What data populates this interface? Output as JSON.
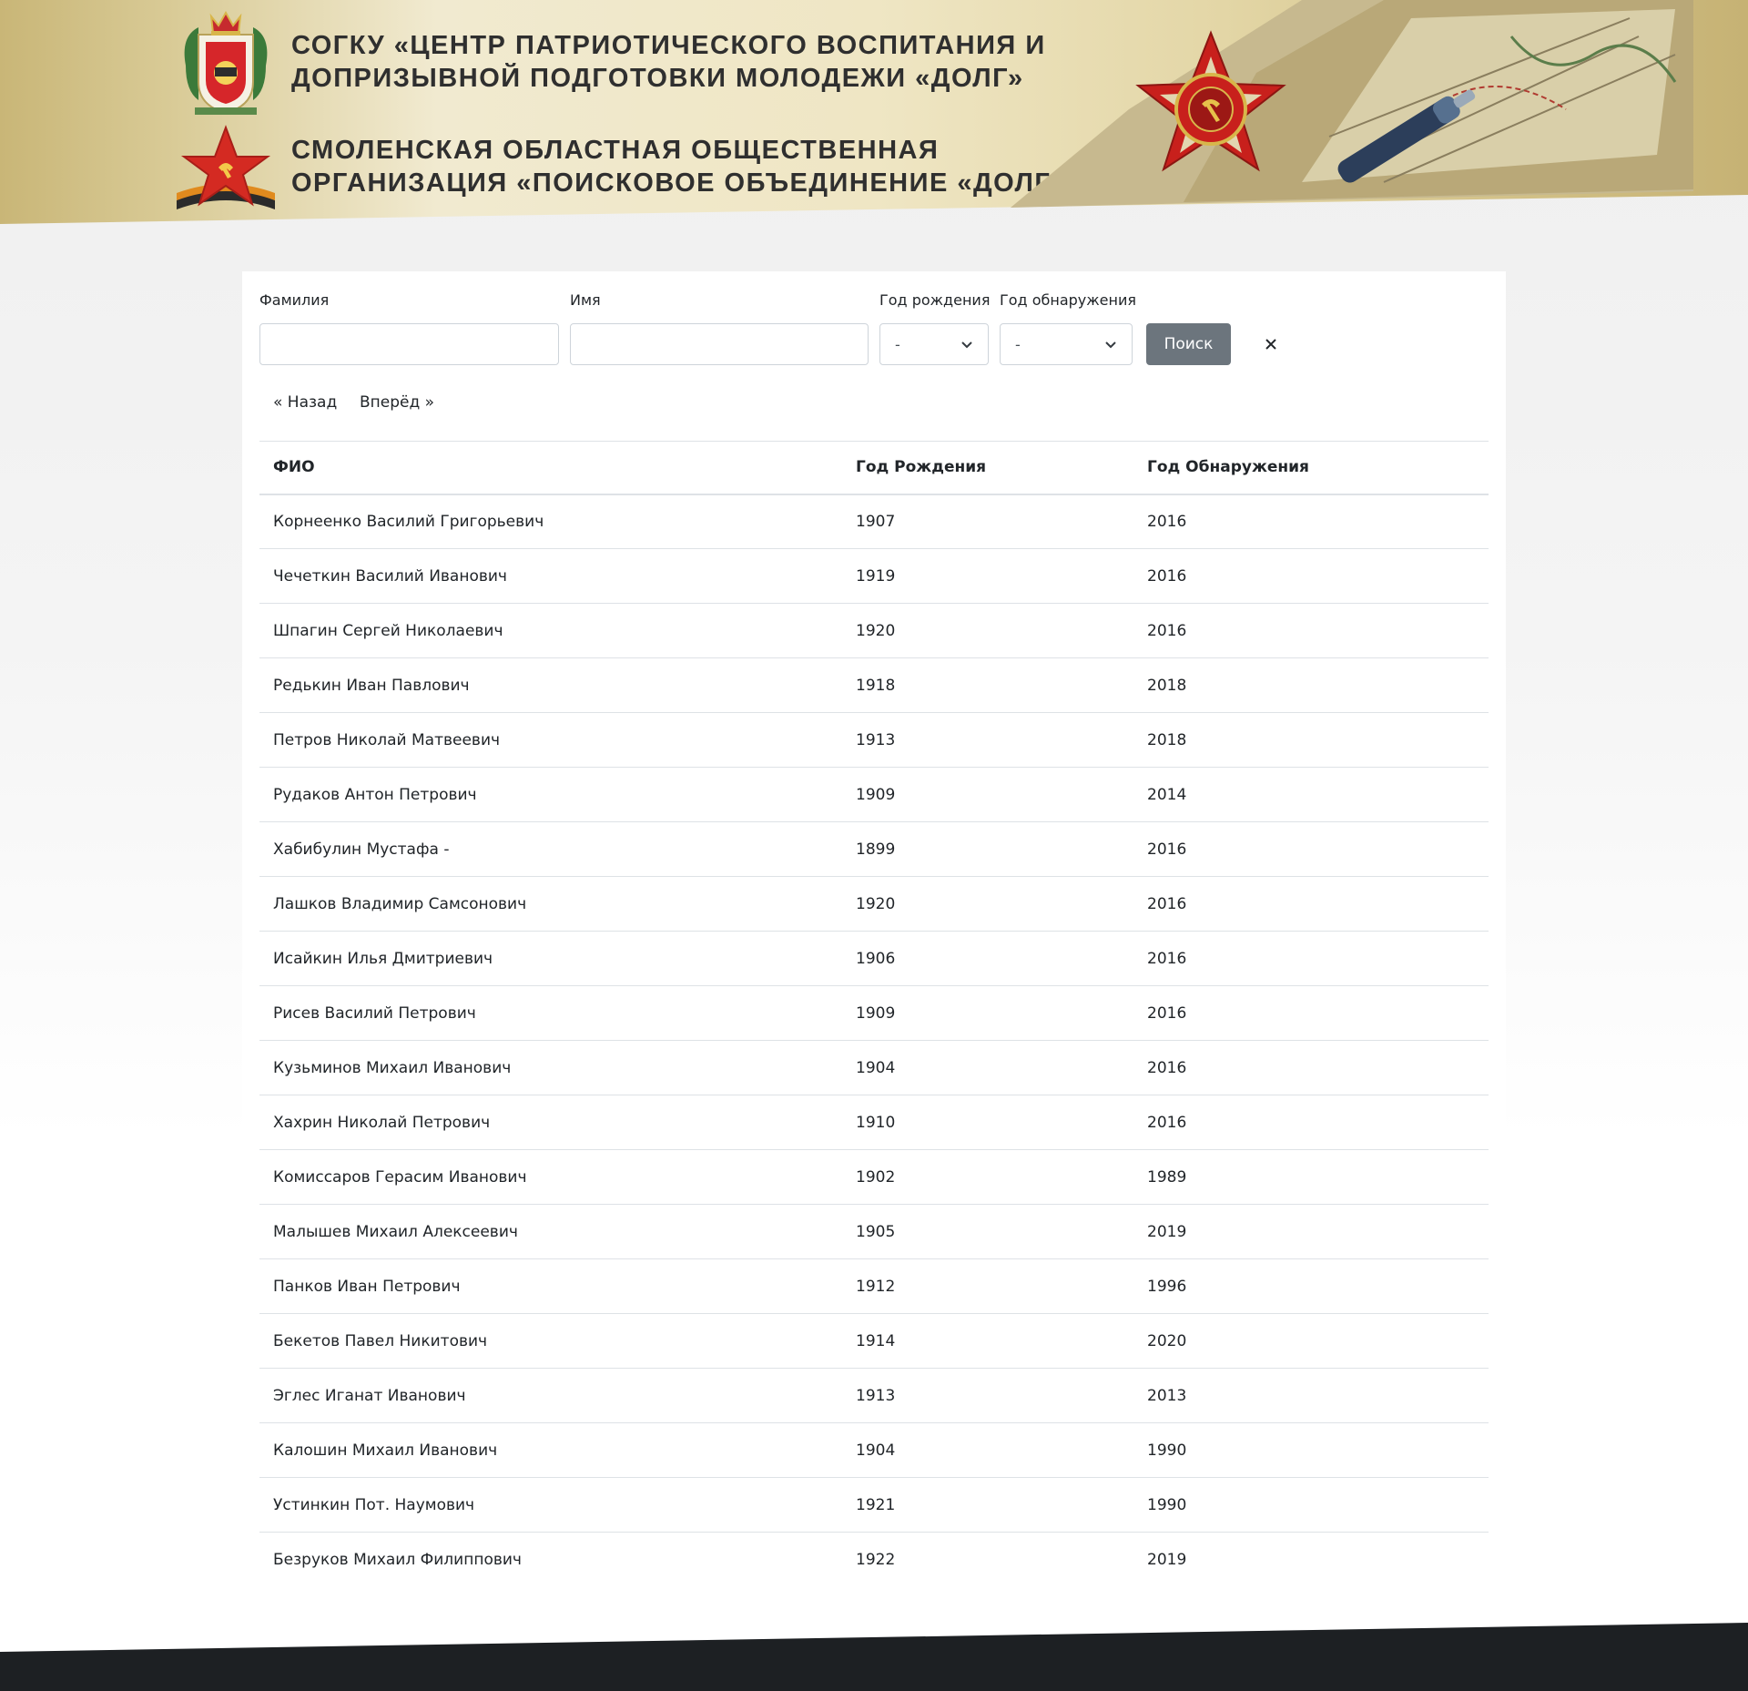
{
  "header": {
    "title_org1_line1": "СОГКУ «Центр патриотического воспитания и",
    "title_org1_line2": "допризывной подготовки молодежи «Долг»",
    "title_org2_line1": "Смоленская областная общественная",
    "title_org2_line2": "организация «Поисковое объединение «Долг»",
    "colors": {
      "banner_gold": "#cbb97a",
      "banner_light": "#f1ead0",
      "text_dark": "#2f2f2f",
      "order_red": "#c8201c"
    }
  },
  "search_form": {
    "surname_label": "Фамилия",
    "surname_value": "",
    "name_label": "Имя",
    "name_value": "",
    "birth_year_label": "Год рождения",
    "birth_year_selected": "-",
    "found_year_label": "Год обнаружения",
    "found_year_selected": "-",
    "search_button": "Поиск",
    "clear_icon": "close-icon",
    "button_color": "#6c757d"
  },
  "pagination": {
    "prev": "« Назад",
    "next": "Вперёд »"
  },
  "table": {
    "headers": {
      "name": "ФИО",
      "birth_year": "Год Рождения",
      "found_year": "Год Обнаружения"
    },
    "rows": [
      {
        "name": "Корнеенко Василий Григорьевич",
        "birth_year": "1907",
        "found_year": "2016"
      },
      {
        "name": "Чечеткин Василий Иванович",
        "birth_year": "1919",
        "found_year": "2016"
      },
      {
        "name": "Шпагин Сергей Николаевич",
        "birth_year": "1920",
        "found_year": "2016"
      },
      {
        "name": "Редькин Иван Павлович",
        "birth_year": "1918",
        "found_year": "2018"
      },
      {
        "name": "Петров Николай Матвеевич",
        "birth_year": "1913",
        "found_year": "2018"
      },
      {
        "name": "Рудаков Антон Петрович",
        "birth_year": "1909",
        "found_year": "2014"
      },
      {
        "name": "Хабибулин Мустафа -",
        "birth_year": "1899",
        "found_year": "2016"
      },
      {
        "name": "Лашков Владимир Самсонович",
        "birth_year": "1920",
        "found_year": "2016"
      },
      {
        "name": "Исайкин Илья Дмитриевич",
        "birth_year": "1906",
        "found_year": "2016"
      },
      {
        "name": "Рисев Василий Петрович",
        "birth_year": "1909",
        "found_year": "2016"
      },
      {
        "name": "Кузьминов Михаил Иванович",
        "birth_year": "1904",
        "found_year": "2016"
      },
      {
        "name": "Хахрин Николай Петрович",
        "birth_year": "1910",
        "found_year": "2016"
      },
      {
        "name": "Комиссаров Герасим Иванович",
        "birth_year": "1902",
        "found_year": "1989"
      },
      {
        "name": "Малышев Михаил Алексеевич",
        "birth_year": "1905",
        "found_year": "2019"
      },
      {
        "name": "Панков Иван Петрович",
        "birth_year": "1912",
        "found_year": "1996"
      },
      {
        "name": "Бекетов Павел Никитович",
        "birth_year": "1914",
        "found_year": "2020"
      },
      {
        "name": "Эглес Иганат Иванович",
        "birth_year": "1913",
        "found_year": "2013"
      },
      {
        "name": "Калошин Михаил Иванович",
        "birth_year": "1904",
        "found_year": "1990"
      },
      {
        "name": "Устинкин Пот. Наумович",
        "birth_year": "1921",
        "found_year": "1990"
      },
      {
        "name": "Безруков Михаил Филиппович",
        "birth_year": "1922",
        "found_year": "2019"
      }
    ]
  },
  "footer": {
    "color": "#1d2023"
  }
}
